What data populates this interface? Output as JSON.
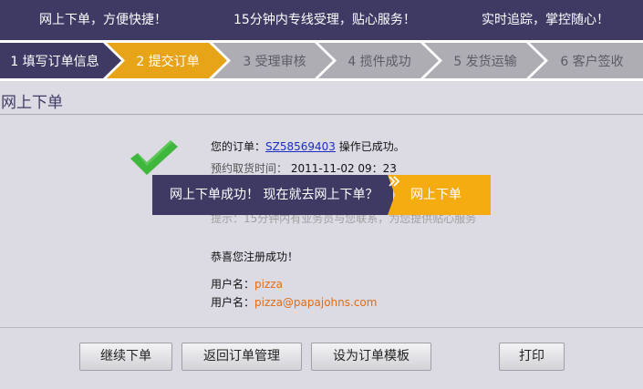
{
  "banner": {
    "slogan_1": "网上下单，方便快捷！",
    "slogan_2": "15分钟内专线受理，贴心服务！",
    "slogan_3": "实时追踪，掌控随心！"
  },
  "steps": {
    "current_index": 1,
    "items": [
      {
        "label": "1 填写订单信息",
        "state": "done"
      },
      {
        "label": "2 提交订单",
        "state": "active"
      },
      {
        "label": "3 受理审核",
        "state": "pending"
      },
      {
        "label": "4 揽件成功",
        "state": "pending"
      },
      {
        "label": "5 发货运输",
        "state": "pending"
      },
      {
        "label": "6 客户签收",
        "state": "pending"
      }
    ]
  },
  "page": {
    "title": "网上下单"
  },
  "result": {
    "order_prefix": "您的订单：",
    "order_number": "SZ58569403",
    "order_suffix": "操作已成功。",
    "pickup_label": "预约取货时间：",
    "pickup_time": "2011-11-02  09：23",
    "hint": "提示：15分钟内有业务员与您联系，为您提供贴心服务",
    "register_success": "恭喜您注册成功！",
    "username_label": "用户名：",
    "username_value": "pizza",
    "email_label": "用户名：",
    "email_value": "pizza@papajohns.com"
  },
  "overlay": {
    "message": "网上下单成功！ 现在就去网上下单？",
    "button_label": "网上下单"
  },
  "actions": {
    "continue_label": "继续下单",
    "back_label": "返回订单管理",
    "template_label": "设为订单模板",
    "print_label": "打印"
  },
  "colors": {
    "banner_bg": "#3e3a64",
    "step_done": "#3e3a64",
    "step_active": "#e7a419",
    "step_pending": "#aeadb4",
    "success_green": "#3fb63c",
    "overlay_bg": "#3e3a64",
    "overlay_button": "#f4ac10",
    "highlight_orange": "#e06c14",
    "link_blue": "#1a2fc2"
  }
}
